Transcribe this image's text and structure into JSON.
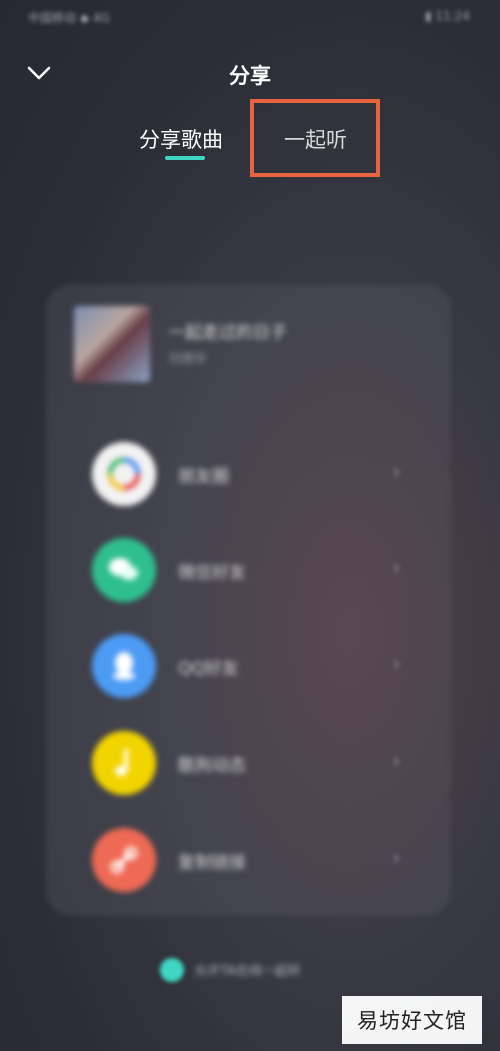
{
  "status_bar": {
    "left": "中国移动 ◆ 4G",
    "right": "▮ 11:24"
  },
  "header": {
    "title": "分享",
    "collapse_icon": "chevron-down-icon"
  },
  "tabs": [
    {
      "label": "分享歌曲",
      "active": true
    },
    {
      "label": "一起听",
      "active": false
    }
  ],
  "highlight_color": "#e8643f",
  "accent_color": "#3fd6c3",
  "song": {
    "title": "一起走过的日子",
    "artist": "刘德华"
  },
  "share_options": [
    {
      "label": "朋友圈",
      "icon": "moments-icon",
      "color": "#f2f2f2"
    },
    {
      "label": "微信好友",
      "icon": "wechat-icon",
      "color": "#2fbf8f"
    },
    {
      "label": "QQ好友",
      "icon": "qq-icon",
      "color": "#4c9bf5"
    },
    {
      "label": "酷狗动态",
      "icon": "music-note-icon",
      "color": "#f2d400"
    },
    {
      "label": "复制链接",
      "icon": "link-icon",
      "color": "#ef6a55"
    }
  ],
  "footer": {
    "text": "允许TA在线一起听"
  },
  "watermark": "易坊好文馆"
}
